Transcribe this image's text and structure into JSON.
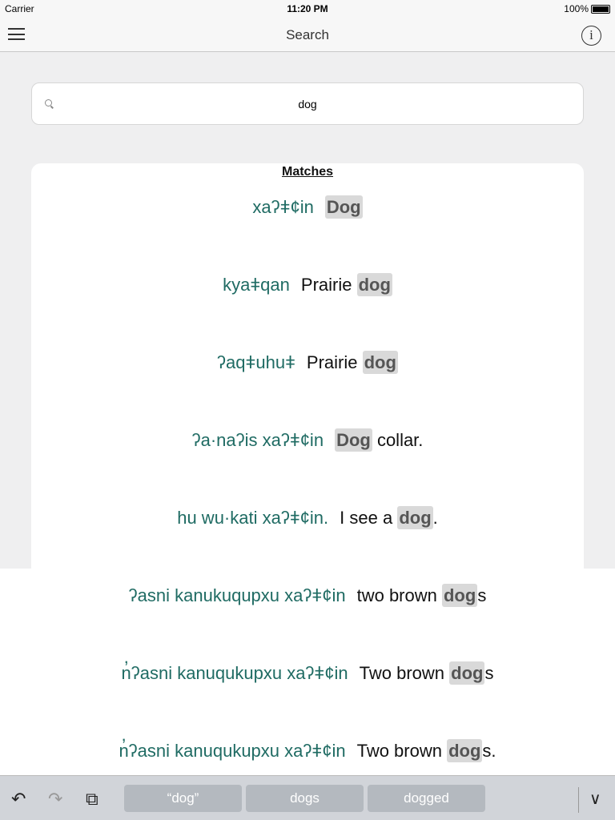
{
  "status": {
    "carrier": "Carrier",
    "time": "11:20 PM",
    "battery": "100%"
  },
  "nav": {
    "title": "Search",
    "menu_icon": "hamburger-icon",
    "info_icon": "info-icon",
    "info_glyph": "i"
  },
  "search": {
    "value": "dog",
    "icon": "magnifier-icon"
  },
  "results": {
    "heading": "Matches",
    "rows": [
      {
        "native": "xaʔǂ¢in",
        "pre": "",
        "hl": "Dog",
        "post": ""
      },
      {
        "native": "kyaǂqan",
        "pre": "Prairie ",
        "hl": "dog",
        "post": ""
      },
      {
        "native": "ʔaqǂuhuǂ",
        "pre": "Prairie ",
        "hl": "dog",
        "post": ""
      },
      {
        "native": "ʔa·naʔis xaʔǂ¢in",
        "pre": "",
        "hl": "Dog",
        "post": " collar."
      },
      {
        "native": "hu wu·kati xaʔǂ¢in.",
        "pre": "I see a ",
        "hl": "dog",
        "post": "."
      },
      {
        "native": "ʔasni kanukuqupxu xaʔǂ¢in",
        "pre": "two brown ",
        "hl": "dog",
        "post": "s"
      },
      {
        "native": "n̓ʔasni kanuqukupxu xaʔǂ¢in",
        "pre": "Two brown ",
        "hl": "dog",
        "post": "s"
      },
      {
        "native": "n̓ʔasni kanuqukupxu xaʔǂ¢in",
        "pre": "Two brown ",
        "hl": "dog",
        "post": "s."
      }
    ]
  },
  "keyboard": {
    "suggestions": [
      "“dog”",
      "dogs",
      "dogged"
    ],
    "undo_glyph": "↶",
    "redo_glyph": "↷",
    "paste_glyph": "⧉",
    "dismiss_glyph": "∨"
  }
}
